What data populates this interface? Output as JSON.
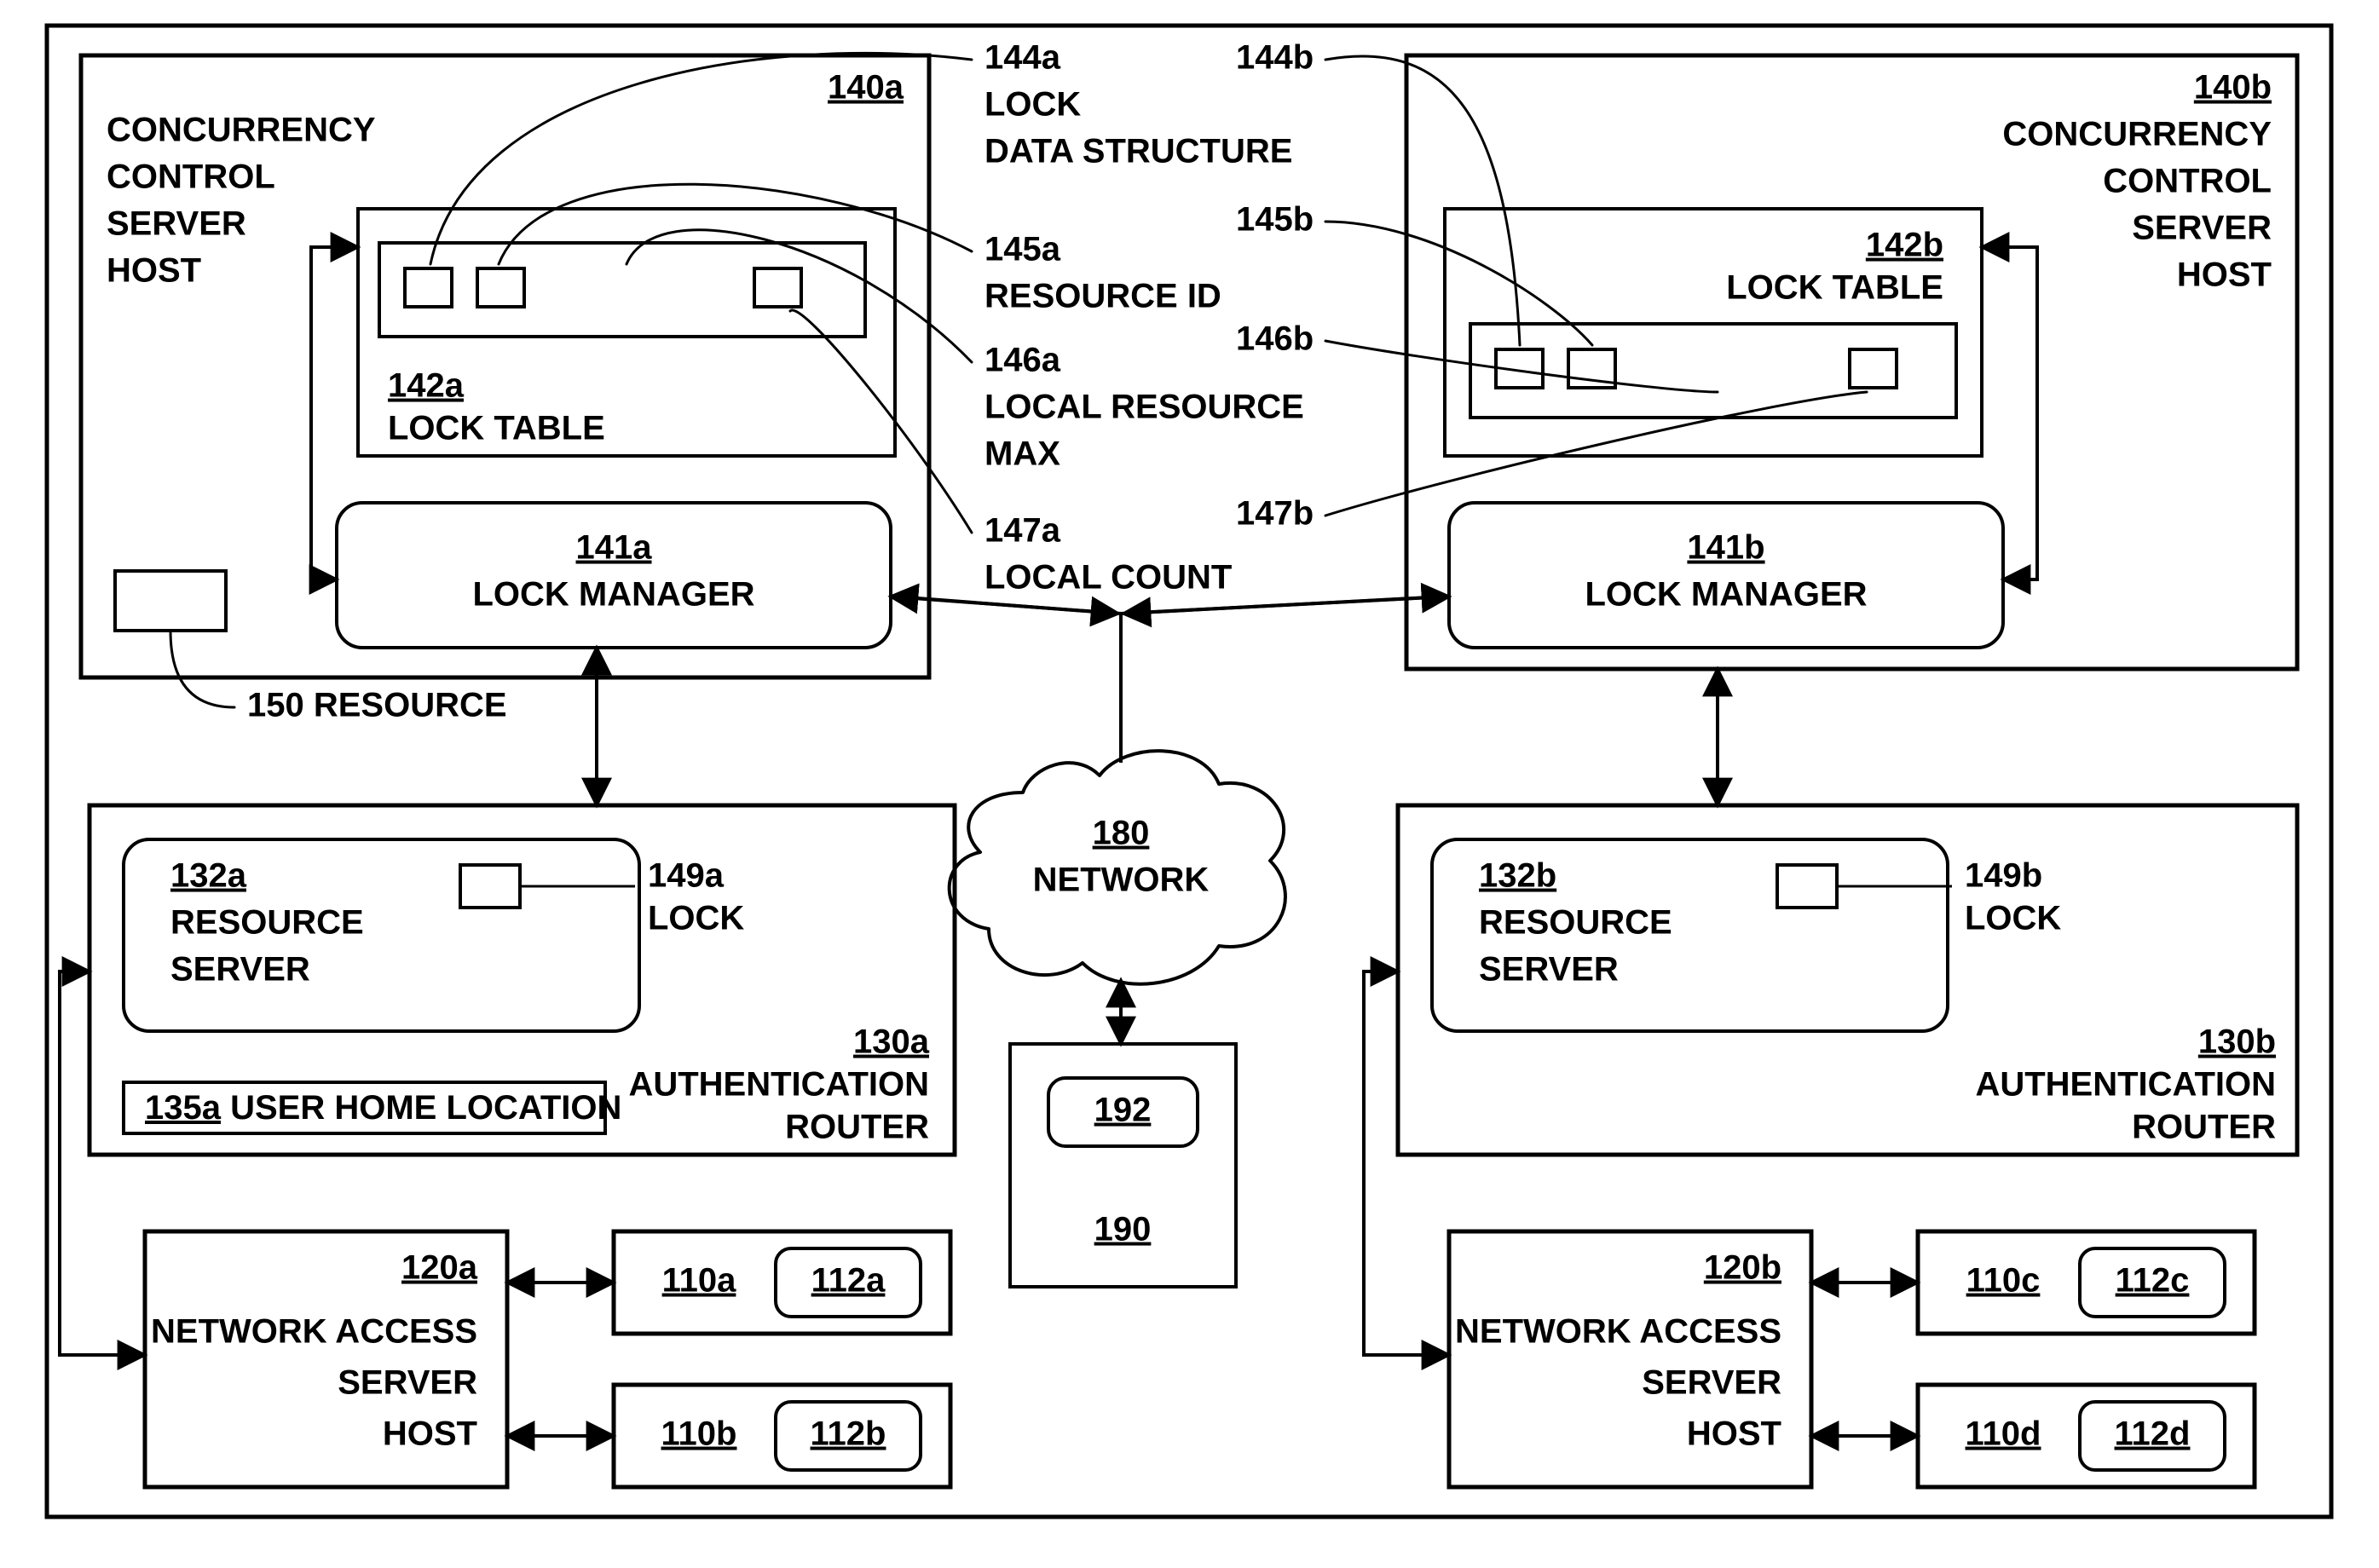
{
  "labels": {
    "ccsh_a_id": "140a",
    "ccsh_a_text1": "CONCURRENCY",
    "ccsh_a_text2": "CONTROL",
    "ccsh_a_text3": "SERVER",
    "ccsh_a_text4": "HOST",
    "ccsh_b_id": "140b",
    "ccsh_b_text1": "CONCURRENCY",
    "ccsh_b_text2": "CONTROL",
    "ccsh_b_text3": "SERVER",
    "ccsh_b_text4": "HOST",
    "locktable_a_id": "142a",
    "locktable_a_text": "LOCK TABLE",
    "locktable_b_id": "142b",
    "locktable_b_text": "LOCK TABLE",
    "lockmgr_a_id": "141a",
    "lockmgr_a_text": "LOCK MANAGER",
    "lockmgr_b_id": "141b",
    "lockmgr_b_text": "LOCK MANAGER",
    "cb_144a": "144a",
    "cb_144a_t1": "LOCK",
    "cb_144a_t2": "DATA  STRUCTURE",
    "cb_144b": "144b",
    "cb_145a": "145a",
    "cb_145a_t": "RESOURCE ID",
    "cb_145b": "145b",
    "cb_146a": "146a",
    "cb_146a_t1": "LOCAL RESOURCE",
    "cb_146a_t2": "MAX",
    "cb_146b": "146b",
    "cb_147a": "147a",
    "cb_147a_t": "LOCAL COUNT",
    "cb_147b": "147b",
    "resource_150": "150 RESOURCE",
    "authrouter_a_id": "130a",
    "authrouter_a_text1": "AUTHENTICATION",
    "authrouter_a_text2": "ROUTER",
    "authrouter_b_id": "130b",
    "authrouter_b_text1": "AUTHENTICATION",
    "authrouter_b_text2": "ROUTER",
    "resourceserver_a_id": "132a",
    "resourceserver_b_id": "132b",
    "resourceserver_text1": "RESOURCE",
    "resourceserver_text2": "SERVER",
    "lock_a": "149a",
    "lock_a_text": "LOCK",
    "lock_b": "149b",
    "lock_b_text": "LOCK",
    "userhome_id": "135a",
    "userhome_text": "USER HOME LOCATION",
    "network_id": "180",
    "network_text": "NETWORK",
    "device_190": "190",
    "device_192": "192",
    "nas_a_id": "120a",
    "nas_b_id": "120b",
    "nas_text1": "NETWORK ACCESS",
    "nas_text2": "SERVER",
    "nas_text3": "HOST",
    "n110a": "110a",
    "n112a": "112a",
    "n110b": "110b",
    "n112b": "112b",
    "n110c": "110c",
    "n112c": "112c",
    "n110d": "110d",
    "n112d": "112d"
  }
}
